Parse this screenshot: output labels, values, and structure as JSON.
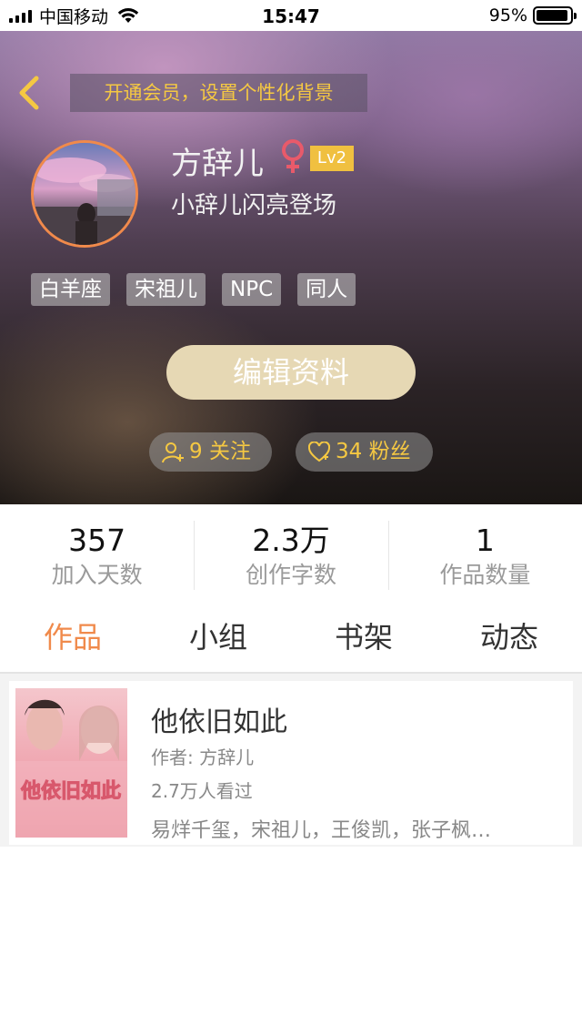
{
  "status_bar": {
    "carrier": "中国移动",
    "time": "15:47",
    "battery_percent": "95%",
    "battery_level": 0.95
  },
  "header": {
    "vip_banner": "开通会员，设置个性化背景"
  },
  "profile": {
    "username": "方辞儿",
    "gender": "female",
    "level": "Lv2",
    "signature": "小辞儿闪亮登场",
    "tags": [
      "白羊座",
      "宋祖儿",
      "NPC",
      "同人"
    ],
    "edit_label": "编辑资料",
    "following_label": "9 关注",
    "fans_label": "34 粉丝"
  },
  "stats": [
    {
      "value": "357",
      "label": "加入天数"
    },
    {
      "value": "2.3万",
      "label": "创作字数"
    },
    {
      "value": "1",
      "label": "作品数量"
    }
  ],
  "tabs": [
    {
      "label": "作品",
      "active": true
    },
    {
      "label": "小组",
      "active": false
    },
    {
      "label": "书架",
      "active": false
    },
    {
      "label": "动态",
      "active": false
    }
  ],
  "works": [
    {
      "title": "他依旧如此",
      "author": "作者: 方辞儿",
      "views": "2.7万人看过",
      "tags": "易烊千玺，宋祖儿，王俊凯，张子枫…",
      "cover_text": "他依旧如此"
    }
  ],
  "colors": {
    "accent": "#f08a4b",
    "gold": "#f5c842",
    "level_badge": "#f0c040",
    "gender_icon": "#e85a6a"
  }
}
